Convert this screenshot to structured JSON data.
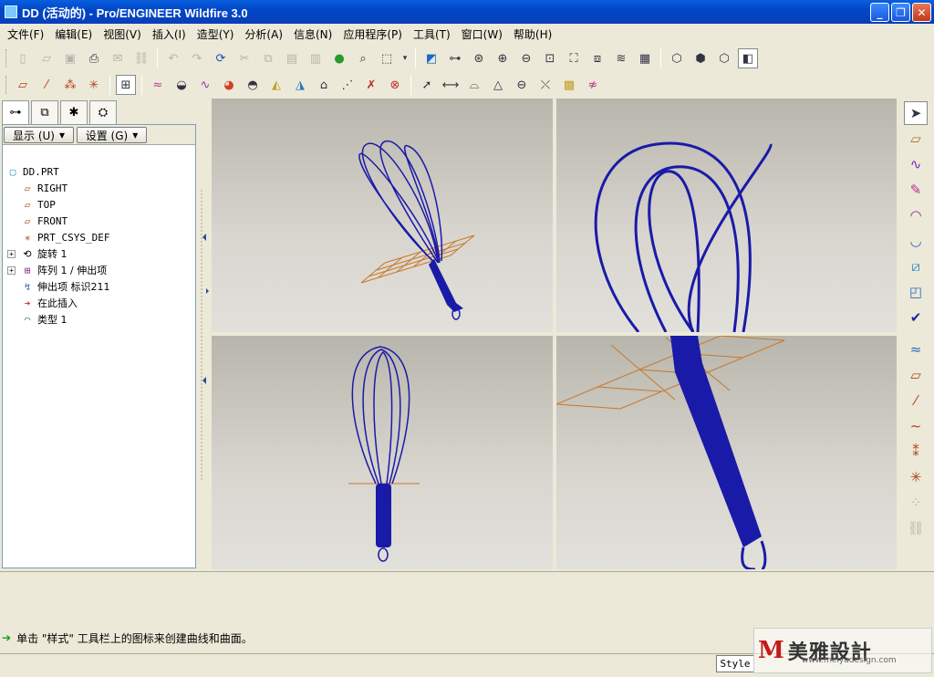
{
  "window": {
    "title": "DD (活动的) - Pro/ENGINEER Wildfire 3.0",
    "min": "_",
    "max": "❐",
    "close": "✕"
  },
  "menu": [
    "文件(F)",
    "编辑(E)",
    "视图(V)",
    "插入(I)",
    "造型(Y)",
    "分析(A)",
    "信息(N)",
    "应用程序(P)",
    "工具(T)",
    "窗口(W)",
    "帮助(H)"
  ],
  "navigator": {
    "show_label": "显示 (U)",
    "settings_label": "设置 (G)"
  },
  "tree": [
    {
      "label": "DD.PRT",
      "icon": "part-icon"
    },
    {
      "label": "RIGHT",
      "icon": "datum-plane-icon"
    },
    {
      "label": "TOP",
      "icon": "datum-plane-icon"
    },
    {
      "label": "FRONT",
      "icon": "datum-plane-icon"
    },
    {
      "label": "PRT_CSYS_DEF",
      "icon": "csys-icon"
    },
    {
      "label": "旋转 1",
      "icon": "revolve-icon"
    },
    {
      "label": "阵列 1 / 伸出项",
      "icon": "pattern-icon"
    },
    {
      "label": "伸出项 标识211",
      "icon": "sweep-icon"
    },
    {
      "label": "在此插入",
      "icon": "insert-here-icon"
    },
    {
      "label": "类型 1",
      "icon": "style-icon"
    }
  ],
  "message": "单击 \"样式\" 工具栏上的图标来创建曲线和曲面。",
  "status": {
    "style": "Style"
  },
  "logo": {
    "mark": "M",
    "text": "美雅設計",
    "url": "www.meiyadesign.com"
  },
  "colors": {
    "model": "#1a1aa8",
    "plane": "#c9772a",
    "viewport_top": "#b8b6ac",
    "viewport_bottom": "#e2e0da"
  }
}
